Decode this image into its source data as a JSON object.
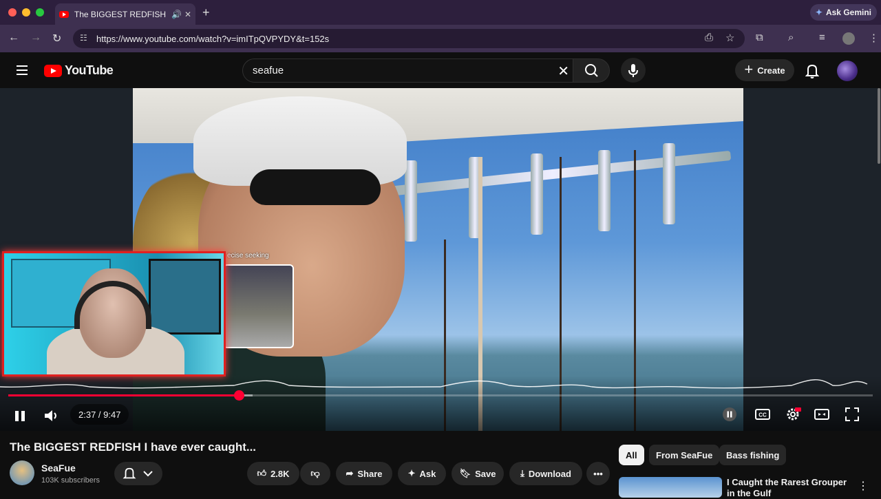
{
  "browser": {
    "tab_title": "The BIGGEST REDFISH I have ever caught...",
    "url": "https://www.youtube.com/watch?v=imITpQVPYDY&t=152s",
    "gemini_label": "Ask Gemini"
  },
  "header": {
    "logo_text": "YouTube",
    "search_value": "seafue",
    "create_label": "Create"
  },
  "player": {
    "preview_label": "ecise seeking",
    "current_time": "2:37",
    "duration": "9:47",
    "time_display": "2:37 / 9:47",
    "played_fraction": 0.267,
    "buffered_fraction": 0.283,
    "accent_color": "#ff0033"
  },
  "video": {
    "title": "The BIGGEST REDFISH I have ever caught...",
    "channel_name": "SeaFue",
    "subscribers": "103K subscribers",
    "likes": "2.8K",
    "share_label": "Share",
    "ask_label": "Ask",
    "save_label": "Save",
    "download_label": "Download"
  },
  "chips": [
    "All",
    "From SeaFue",
    "Bass fishing"
  ],
  "recommendation": {
    "title": "I Caught the Rarest Grouper in the Gulf"
  }
}
